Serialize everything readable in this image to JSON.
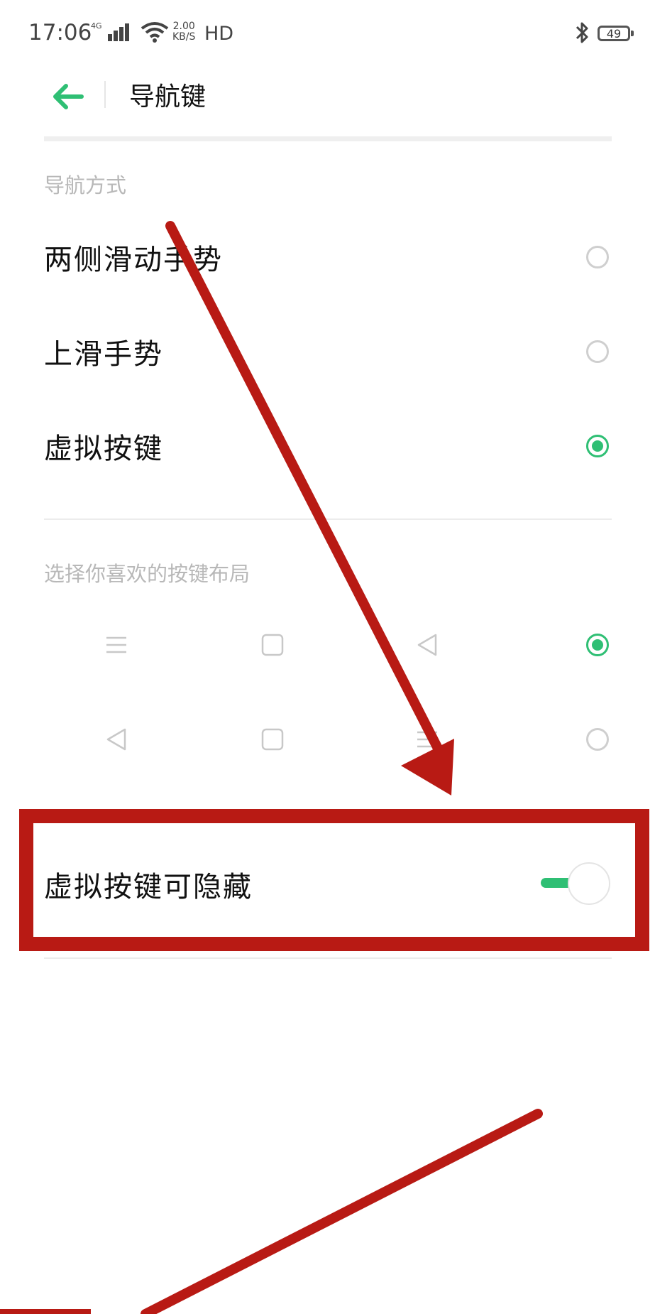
{
  "status_bar": {
    "time": "17:06",
    "network": "4G",
    "speed_value": "2.00",
    "speed_unit": "KB/S",
    "hd": "HD",
    "battery": "49"
  },
  "header": {
    "title": "导航键"
  },
  "navigation_mode": {
    "section_label": "导航方式",
    "options": [
      {
        "label": "两侧滑动手势",
        "selected": false
      },
      {
        "label": "上滑手势",
        "selected": false
      },
      {
        "label": "虚拟按键",
        "selected": true
      }
    ]
  },
  "key_layout": {
    "section_label": "选择你喜欢的按键布局",
    "layouts": [
      {
        "icons": [
          "menu-icon",
          "square-icon",
          "back-triangle-icon"
        ],
        "selected": true
      },
      {
        "icons": [
          "back-triangle-icon",
          "square-icon",
          "menu-icon"
        ],
        "selected": false
      }
    ]
  },
  "hideable_keys": {
    "label": "虚拟按键可隐藏",
    "enabled": true
  },
  "colors": {
    "accent": "#2fbf74",
    "annotation": "#b81a14"
  }
}
